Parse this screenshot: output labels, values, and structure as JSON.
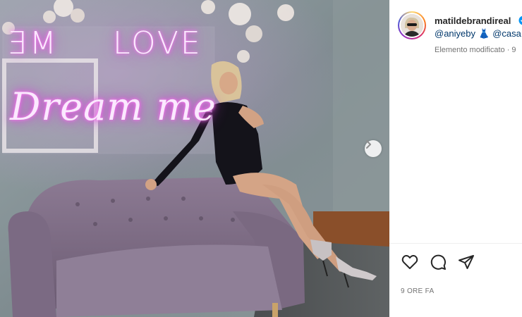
{
  "post": {
    "image_alt_icons": {
      "next": "chevron-right-icon"
    },
    "neon": {
      "love": "LOVE",
      "me": "ME",
      "dream": "Dream  me"
    }
  },
  "header": {
    "username": "matildebrandireal",
    "verified_icon": "verified-badge-icon",
    "mentions": [
      "@aniyeby",
      "👗",
      "@casa"
    ],
    "edited_label": "Elemento modificato · 9"
  },
  "actions": {
    "like_icon": "heart-icon",
    "comment_icon": "comment-icon",
    "share_icon": "share-icon"
  },
  "footer": {
    "timestamp": "9 ORE FA"
  },
  "colors": {
    "link": "#00376b",
    "verified": "#0095f6",
    "neon": "#ff7cf2"
  }
}
